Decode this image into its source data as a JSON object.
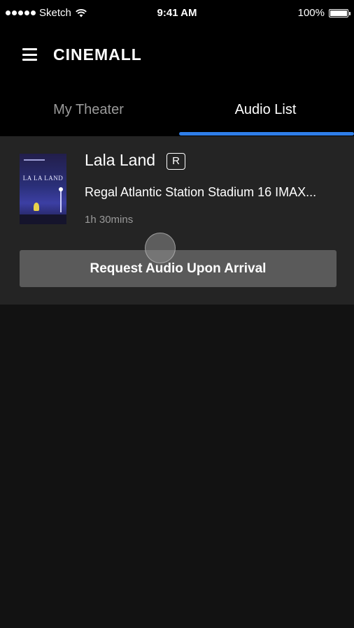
{
  "status_bar": {
    "carrier": "Sketch",
    "time": "9:41 AM",
    "battery_text": "100%",
    "battery_level": 1.0,
    "signal_icon": "signal-dots-icon",
    "wifi_icon": "wifi-icon"
  },
  "header": {
    "logo": "CINEMALL",
    "menu_icon": "hamburger-menu-icon"
  },
  "tabs": [
    {
      "label": "My Theater",
      "active": false
    },
    {
      "label": "Audio List",
      "active": true
    }
  ],
  "card": {
    "movie_title": "Lala Land",
    "rating": "R",
    "theater": "Regal Atlantic Station Stadium 16 IMAX...",
    "duration": "1h 30mins",
    "poster_title": "LA LA LAND",
    "button_label": "Request Audio Upon Arrival"
  },
  "colors": {
    "accent": "#2f7ee8",
    "background": "#121212",
    "card": "#242424",
    "button": "#5a5a5a"
  }
}
